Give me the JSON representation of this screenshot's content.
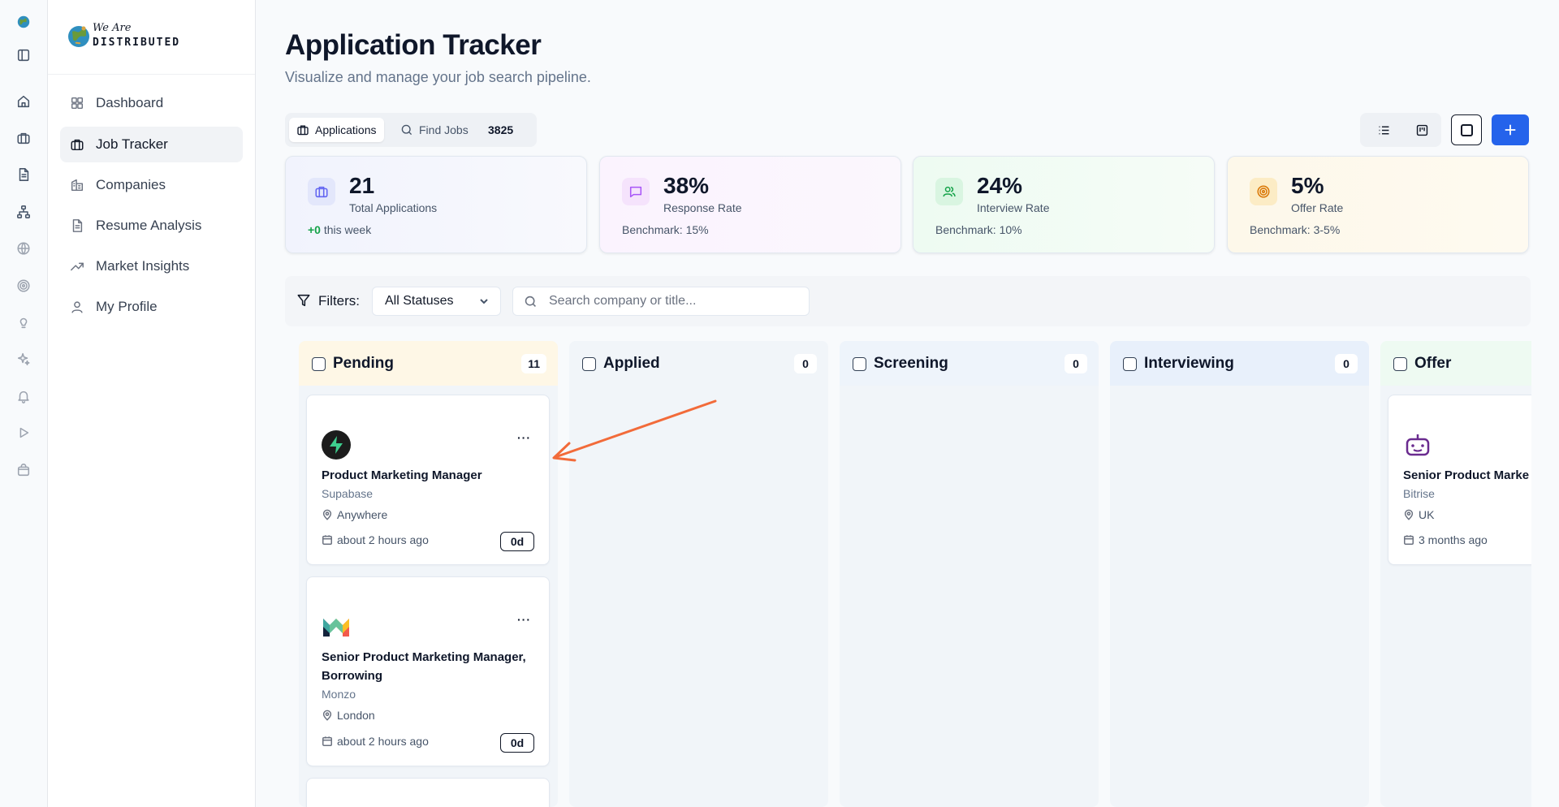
{
  "brand": {
    "line1": "We Are",
    "line2": "DISTRIBUTED"
  },
  "rail": {
    "items": [
      "logo-icon",
      "panel-toggle-icon",
      "home-icon",
      "briefcase-icon",
      "document-icon",
      "network-icon",
      "globe-icon",
      "target-icon",
      "lightbulb-icon",
      "sparkles-icon",
      "bell-icon",
      "play-icon",
      "shopping-bag-icon"
    ]
  },
  "sidebar": {
    "items": [
      {
        "label": "Dashboard",
        "icon": "dashboard-icon"
      },
      {
        "label": "Job Tracker",
        "icon": "briefcase-icon",
        "active": true
      },
      {
        "label": "Companies",
        "icon": "building-icon"
      },
      {
        "label": "Resume Analysis",
        "icon": "document-icon"
      },
      {
        "label": "Market Insights",
        "icon": "trending-up-icon"
      },
      {
        "label": "My Profile",
        "icon": "user-icon"
      }
    ]
  },
  "header": {
    "title": "Application Tracker",
    "subtitle": "Visualize and manage your job search pipeline."
  },
  "tabs": {
    "applications": "Applications",
    "find_jobs": "Find Jobs",
    "count": "3825"
  },
  "stats": [
    {
      "value": "21",
      "label": "Total Applications",
      "foot_highlight": "+0",
      "foot": "this week",
      "color": "#6366f1"
    },
    {
      "value": "38%",
      "label": "Response Rate",
      "foot": "Benchmark: 15%",
      "color": "#a855f7"
    },
    {
      "value": "24%",
      "label": "Interview Rate",
      "foot": "Benchmark: 10%",
      "color": "#16a34a"
    },
    {
      "value": "5%",
      "label": "Offer Rate",
      "foot": "Benchmark: 3-5%",
      "color": "#d97706"
    }
  ],
  "filters": {
    "label": "Filters:",
    "status_selected": "All Statuses",
    "search_placeholder": "Search company or title..."
  },
  "columns": [
    {
      "title": "Pending",
      "count": "11",
      "color": "#fef7e6"
    },
    {
      "title": "Applied",
      "count": "0",
      "color": "#f1f5f9"
    },
    {
      "title": "Screening",
      "count": "0",
      "color": "#eef4fb"
    },
    {
      "title": "Interviewing",
      "count": "0",
      "color": "#e8f0fb"
    },
    {
      "title": "Offer",
      "count": "",
      "color": "#eefaf2"
    }
  ],
  "cards": [
    {
      "title": "Product Marketing Manager",
      "company": "Supabase",
      "location": "Anywhere",
      "date": "about 2 hours ago",
      "age": "0d",
      "logo": "supabase-logo"
    },
    {
      "title": "Senior Product Marketing Manager, Borrowing",
      "company": "Monzo",
      "location": "London",
      "date": "about 2 hours ago",
      "age": "0d",
      "logo": "monzo-logo"
    },
    {
      "title": "Senior Product Marke",
      "company": "Bitrise",
      "location": "UK",
      "date": "3 months ago",
      "logo": "bitrise-logo"
    }
  ],
  "card_menu": "···"
}
